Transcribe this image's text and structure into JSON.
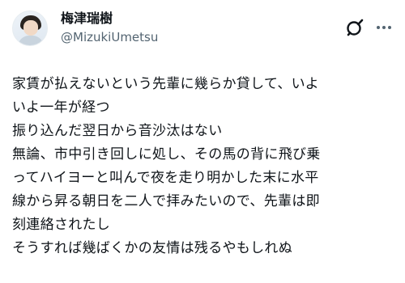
{
  "author": {
    "display_name": "梅津瑞樹",
    "handle": "@MizukiUmetsu"
  },
  "icons": {
    "avatar": "profile-photo",
    "logo": "grok-logo-icon",
    "more": "more-options-icon"
  },
  "post": {
    "lines": [
      "家賃が払えないという先輩に幾らか貸して、いよ",
      "いよ一年が経つ",
      "振り込んだ翌日から音沙汰はない",
      "無論、市中引き回しに処し、その馬の背に飛び乗",
      "ってハイヨーと叫んで夜を走り明かした末に水平",
      "線から昇る朝日を二人で拝みたいので、先輩は即",
      "刻連絡されたし",
      "そうすれば幾ばくかの友情は残るやもしれぬ"
    ]
  }
}
